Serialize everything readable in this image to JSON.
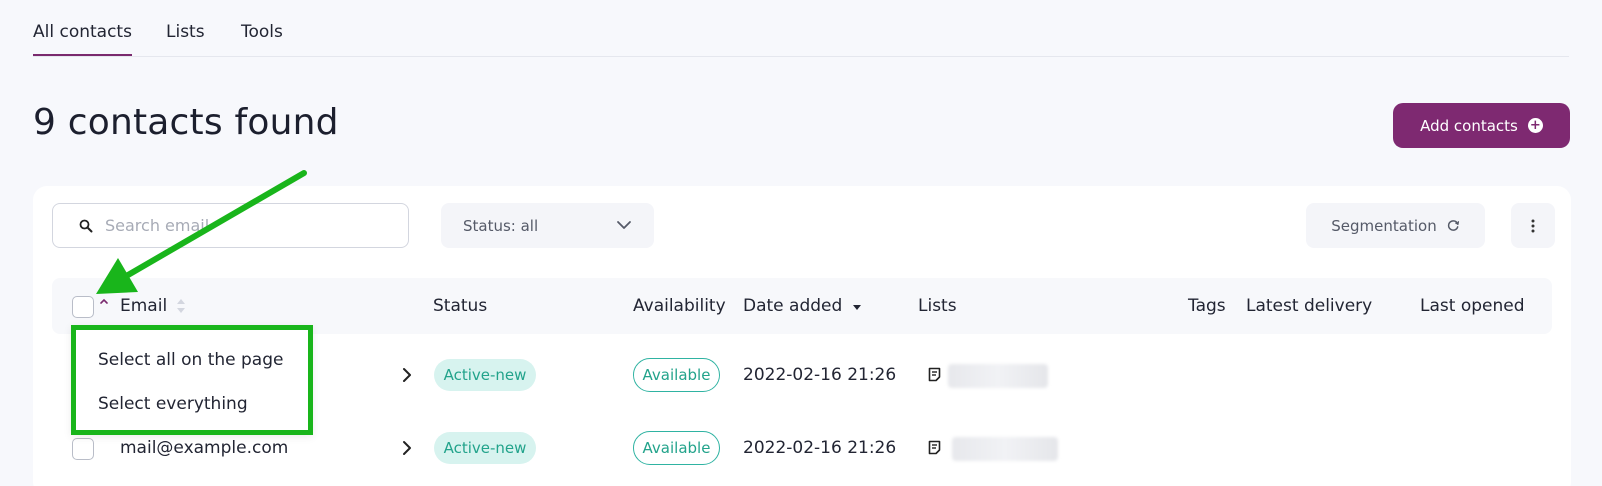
{
  "tabs": [
    {
      "label": "All contacts",
      "active": true
    },
    {
      "label": "Lists",
      "active": false
    },
    {
      "label": "Tools",
      "active": false
    }
  ],
  "title": "9 contacts found",
  "add_button": {
    "label": "Add contacts"
  },
  "search": {
    "placeholder": "Search email"
  },
  "status_filter": {
    "label": "Status: all"
  },
  "segmentation": {
    "label": "Segmentation"
  },
  "columns": {
    "email": "Email",
    "status": "Status",
    "availability": "Availability",
    "date_added": "Date added",
    "lists": "Lists",
    "tags": "Tags",
    "latest_delivery": "Latest delivery",
    "last_opened": "Last opened"
  },
  "select_menu": {
    "options": [
      "Select all on the page",
      "Select everything"
    ]
  },
  "rows": [
    {
      "email": "",
      "status": "Active-new",
      "availability": "Available",
      "date_added": "2022-02-16 21:26"
    },
    {
      "email": "mail@example.com",
      "status": "Active-new",
      "availability": "Available",
      "date_added": "2022-02-16 21:26"
    }
  ],
  "colors": {
    "accent": "#7e2971",
    "badge_text": "#22a38b",
    "badge_bg": "#d7f3ef",
    "highlight": "#19b51b"
  }
}
